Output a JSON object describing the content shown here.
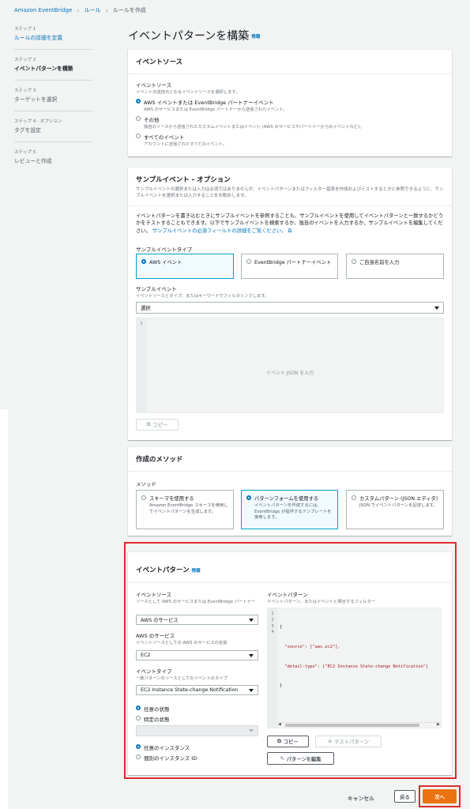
{
  "breadcrumb": {
    "root": "Amazon EventBridge",
    "rules": "ルール",
    "current": "ルールを作成"
  },
  "steps": [
    {
      "num": "ステップ 1",
      "label": "ルールの詳細を定義"
    },
    {
      "num": "ステップ 2",
      "label": "イベントパターンを構築"
    },
    {
      "num": "ステップ 3",
      "label": "ターゲットを選択"
    },
    {
      "num": "ステップ 4 - オプション",
      "label": "タグを設定"
    },
    {
      "num": "ステップ 5",
      "label": "レビューと作成"
    }
  ],
  "page": {
    "title": "イベントパターンを構築",
    "info": "情報"
  },
  "event_source": {
    "header": "イベントソース",
    "label": "イベントソース",
    "desc": "イベントの送信元となるイベントソースを選択します。",
    "options": [
      {
        "label": "AWS イベントまたは EventBridge パートナーイベント",
        "desc": "AWS のサービスまたは EventBridge パートナーから送信されたイベント。",
        "selected": true
      },
      {
        "label": "その他",
        "desc": "独自のソースから送信されたカスタムイベントまたはイベント (AWS のサービスやパートナーからのイベントなど)。",
        "selected": false
      },
      {
        "label": "すべてのイベント",
        "desc": "アカウントに送信されたすべてのイベント。",
        "selected": false
      }
    ]
  },
  "sample": {
    "header": "サンプルイベント - オプション",
    "sub": "サンプルイベントの選択または入力は必須ではありませんが、イベントパターンまたはフィルター基準を作成およびテストするときに参照できるように、サンプルイベントを選択または入力することをお勧めします。",
    "body1": "イベントパターンを書き込むときにサンプルイベントを参照することも、サンプルイベントを使用してイベントパターンと一致するかどうかをテストすることもできます。以下でサンプルイベントを検索するか、独自のイベントを入力するか、サンプルイベントを編集してください。",
    "body_link": "サンプルイベントの必須フィールドの詳細をご覧ください。",
    "type_label": "サンプルイベントタイプ",
    "types": [
      {
        "label": "AWS イベント",
        "selected": true
      },
      {
        "label": "EventBridge パートナーイベント",
        "selected": false
      },
      {
        "label": "ご自身名前を入力",
        "selected": false
      }
    ],
    "event_label": "サンプルイベント",
    "event_desc": "イベントソースとタイプ、またはキーワードでフィルタリングします。",
    "select_value": "選択",
    "editor_line": "1",
    "editor_placeholder": "イベント JSON を入力",
    "copy": "コピー"
  },
  "method": {
    "header": "作成のメソッド",
    "label": "メソッド",
    "options": [
      {
        "label": "スキーマを使用する",
        "desc": "Amazon EventBridge スキーマを使用してイベントパターンを生成します。",
        "selected": false
      },
      {
        "label": "パターンフォームを使用する",
        "desc": "イベントパターンを作成するには、EventBridge が提供するテンプレートを使用します。",
        "selected": true
      },
      {
        "label": "カスタムパターン (JSON エディタ)",
        "desc": "JSON でイベントパターンを記述します。",
        "selected": false
      }
    ]
  },
  "pattern": {
    "header": "イベントパターン",
    "info": "情報",
    "source_label": "イベントソース",
    "source_desc": "ソースとして AWS のサービスまたは EventBridge パートナー",
    "source_value": "AWS のサービス",
    "service_label": "AWS のサービス",
    "service_desc": "イベントソースとしての AWS のサービスの名前",
    "service_value": "EC2",
    "type_label": "イベントタイプ",
    "type_desc": "一致パターンのソースとしてのイベントのタイプ",
    "type_value": "EC2 Instance State-change Notification",
    "state_options": [
      {
        "label": "任意の状態",
        "selected": true
      },
      {
        "label": "特定の状態",
        "selected": false
      }
    ],
    "instance_options": [
      {
        "label": "任意のインスタンス",
        "selected": true
      },
      {
        "label": "個別のインスタンス ID",
        "selected": false
      }
    ],
    "right_label": "イベントパターン",
    "right_desc": "イベントパターン、またはイベントと照合するフィルター",
    "code_lines": [
      "{",
      "  \"source\": [\"aws.ec2\"],",
      "  \"detail-type\": [\"EC2 Instance State-change Notification\"]",
      "}"
    ],
    "line_numbers": [
      "1",
      "2",
      "3",
      "4"
    ],
    "copy": "コピー",
    "test": "テストパターン",
    "edit": "パターンを編集"
  },
  "footer": {
    "cancel": "キャンセル",
    "back": "戻る",
    "next": "次へ"
  }
}
